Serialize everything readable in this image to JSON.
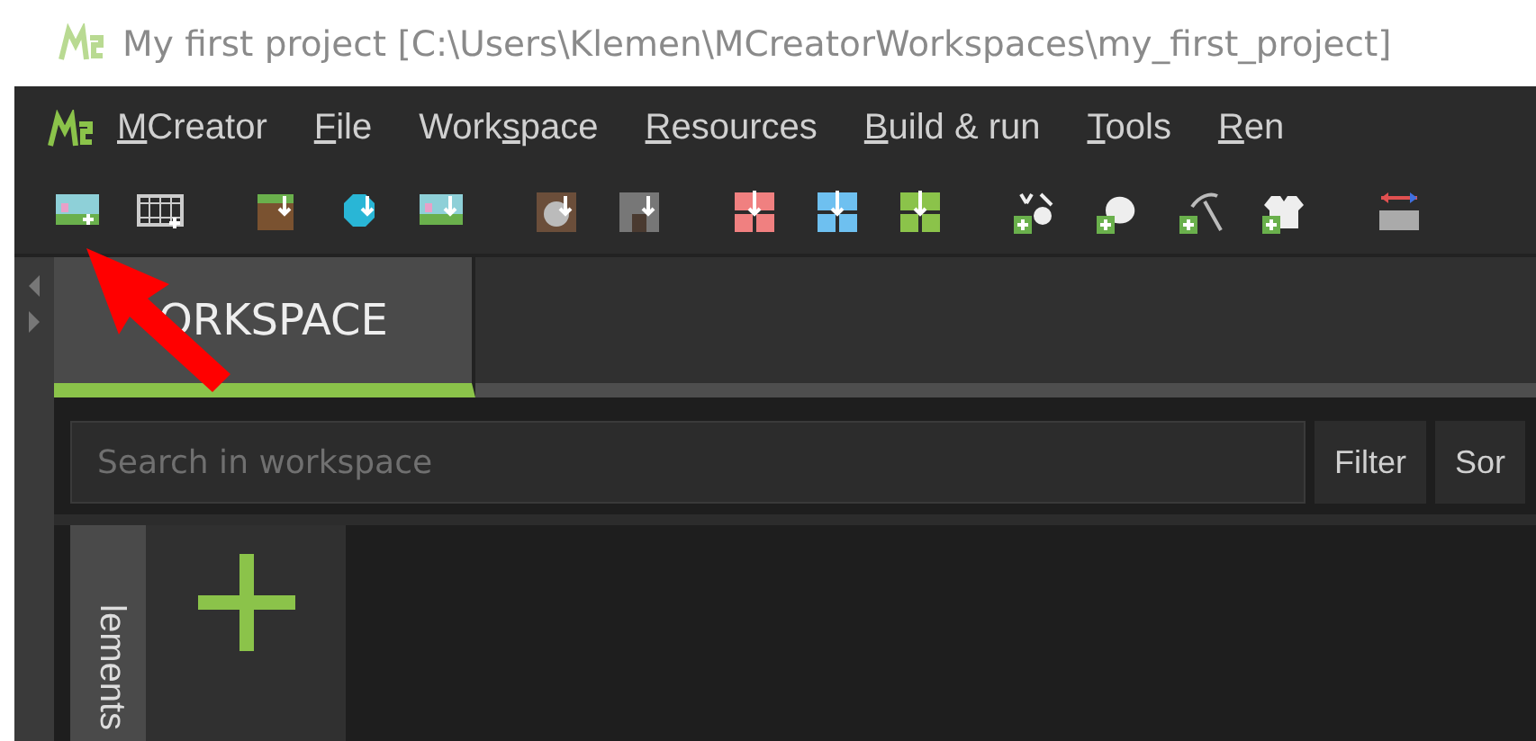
{
  "window": {
    "title": "My first project [C:\\Users\\Klemen\\MCreatorWorkspaces\\my_first_project]"
  },
  "menu": [
    {
      "key": "M",
      "post": "Creator"
    },
    {
      "key": "F",
      "post": "ile"
    },
    {
      "pre": "Work",
      "key": "s",
      "post": "pace"
    },
    {
      "key": "R",
      "post": "esources"
    },
    {
      "key": "B",
      "post": "uild & run"
    },
    {
      "key": "T",
      "post": "ools"
    },
    {
      "key": "R",
      "post": "en"
    }
  ],
  "tabs": [
    {
      "label": "ORKSPACE",
      "selected": true
    }
  ],
  "search": {
    "placeholder": "Search in workspace"
  },
  "buttons": [
    "Filter",
    "Sor"
  ],
  "side_tab": {
    "label": "lements"
  }
}
